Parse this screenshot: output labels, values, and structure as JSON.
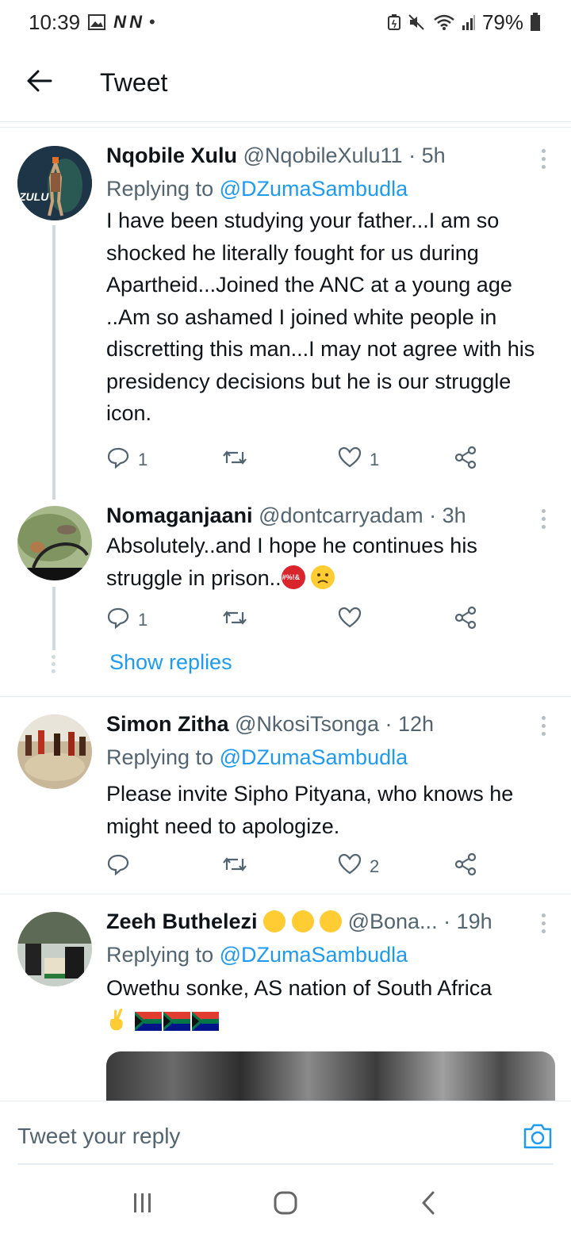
{
  "status_bar": {
    "time": "10:39",
    "battery": "79%",
    "network_label": "N N"
  },
  "header": {
    "title": "Tweet"
  },
  "tweets": [
    {
      "name": "Nqobile Xulu",
      "handle": "@NqobileXulu11",
      "time": "· 5h",
      "replying_prefix": "Replying to",
      "replying_to": "@DZumaSambudla",
      "text": "I have been studying your father...I am so shocked he literally fought for us during Apartheid...Joined the ANC at a young age ..Am so ashamed I joined white people in discretting this man...I may not agree with his presidency decisions but he is our struggle icon.",
      "avatar_label": "ZULU",
      "reply_count": "1",
      "retweet_count": "",
      "like_count": "1"
    },
    {
      "name": "Nomaganjaani",
      "handle": "@dontcarryadam",
      "time": "· 3h",
      "text": "Absolutely..and I hope he continues his struggle in prison..",
      "emoji_label": "#%!&",
      "reply_count": "1",
      "retweet_count": "",
      "like_count": ""
    },
    {
      "name": "Simon Zitha",
      "handle": "@NkosiTsonga",
      "time": "· 12h",
      "replying_prefix": "Replying to",
      "replying_to": "@DZumaSambudla",
      "text": "Please invite Sipho Pityana, who knows he might need to apologize.",
      "reply_count": "",
      "retweet_count": "",
      "like_count": "2"
    },
    {
      "name": "Zeeh Buthelezi",
      "handle": "@Bona...",
      "time": "· 19h",
      "replying_prefix": "Replying to",
      "replying_to": "@DZumaSambudla",
      "text": "Owethu sonke, AS nation of South Africa"
    }
  ],
  "show_replies": "Show replies",
  "reply_bar": {
    "placeholder": "Tweet your reply"
  },
  "colors": {
    "accent": "#1d9bf0",
    "secondary_text": "#536471",
    "divider": "#e6ecf0"
  },
  "icons": [
    "back-arrow-icon",
    "reply-icon",
    "retweet-icon",
    "like-icon",
    "share-icon",
    "more-icon",
    "camera-icon",
    "recent-apps-icon",
    "home-icon",
    "back-nav-icon"
  ]
}
